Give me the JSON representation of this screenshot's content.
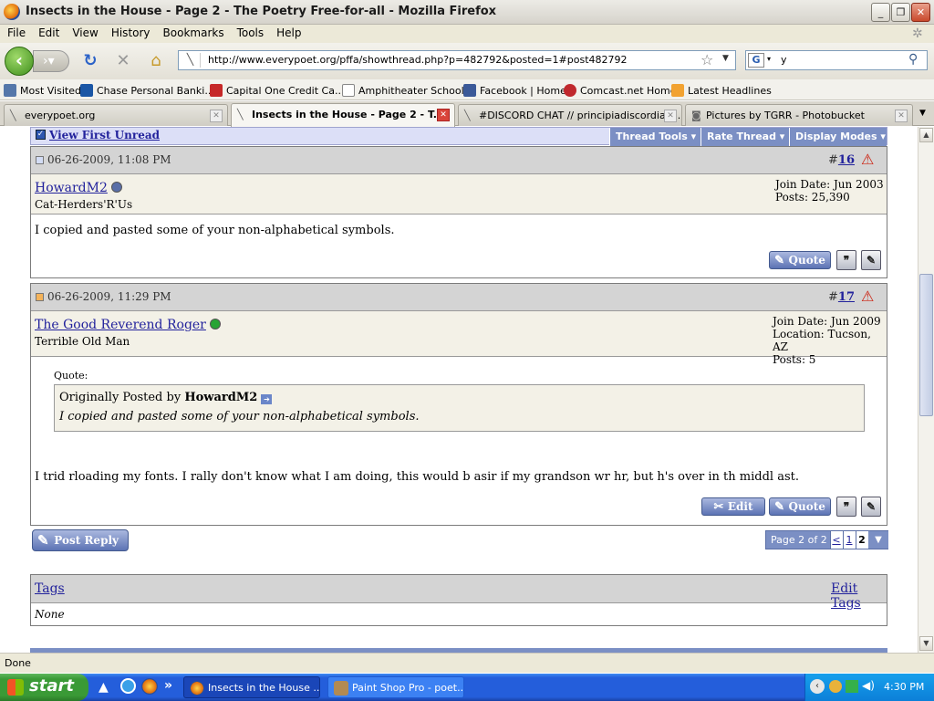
{
  "window": {
    "title": "Insects in the House - Page 2 - The Poetry Free-for-all - Mozilla Firefox",
    "min": "_",
    "max": "❐",
    "close": "✕"
  },
  "menu": [
    "File",
    "Edit",
    "View",
    "History",
    "Bookmarks",
    "Tools",
    "Help"
  ],
  "nav": {
    "url": "http://www.everypoet.org/pffa/showthread.php?p=482792&posted=1#post482792",
    "search_value": "y",
    "search_engine": "G"
  },
  "bookmarks": [
    "Most Visited",
    "Chase Personal Banki...",
    "Capital One Credit Ca...",
    "Amphitheater Schools",
    "Facebook | Home",
    "Comcast.net Home",
    "Latest Headlines"
  ],
  "tabs": [
    {
      "label": "everypoet.org",
      "active": false
    },
    {
      "label": "Insects in the House - Page 2 - T...",
      "active": true
    },
    {
      "label": "#DISCORD CHAT // principiadiscordia.c...",
      "active": false
    },
    {
      "label": "Pictures by TGRR - Photobucket",
      "active": false
    }
  ],
  "thread_controls": {
    "view_first_unread": "View First Unread",
    "thread_tools": "Thread Tools",
    "rate_thread": "Rate Thread",
    "display_modes": "Display Modes"
  },
  "posts": [
    {
      "date": "06-26-2009, 11:08 PM",
      "number_prefix": "#",
      "number": "16",
      "username": "HowardM2",
      "user_title": "Cat-Herders'R'Us",
      "status_color": "#5a6fa8",
      "stats": [
        "Join Date: Jun 2003",
        "Posts: 25,390"
      ],
      "body": "I copied and pasted some of your non-alphabetical symbols.",
      "quote_button": "Quote"
    },
    {
      "date": "06-26-2009, 11:29 PM",
      "number_prefix": "#",
      "number": "17",
      "username": "The Good Reverend Roger",
      "user_title": "Terrible Old Man",
      "status_color": "#27a434",
      "stats": [
        "Join Date: Jun 2009",
        "Location: Tucson, AZ",
        "Posts: 5"
      ],
      "quote_label": "Quote:",
      "quote_origin_prefix": "Originally Posted by",
      "quote_origin_user": "HowardM2",
      "quote_text": "I copied and pasted some of your non-alphabetical symbols.",
      "body": "I trid rloading my fonts. I rally don't know what I am doing, this would b asir if my grandson wr hr, but h's over in th middl ast.",
      "edit_button": "Edit",
      "quote_button": "Quote"
    }
  ],
  "post_reply": "Post Reply",
  "pager": {
    "label": "Page 2 of 2",
    "prev": "<",
    "p1": "1",
    "p2": "2",
    "dropdown": "▼"
  },
  "tags": {
    "title": "Tags",
    "edit": "Edit Tags",
    "value": "None"
  },
  "status": "Done",
  "taskbar": {
    "start": "start",
    "tasks": [
      "Insects in the House ...",
      "Paint Shop Pro - poet..."
    ],
    "clock": "4:30 PM"
  }
}
